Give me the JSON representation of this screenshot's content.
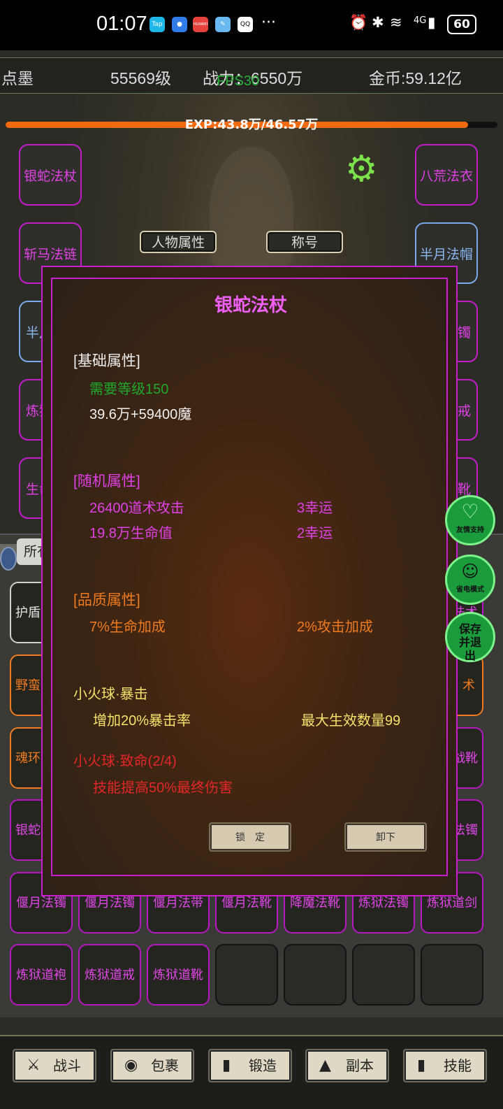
{
  "status_bar": {
    "time": "01:07",
    "apps": [
      "Tap",
      "●",
      "HUAWEI",
      "✎",
      "QQ"
    ],
    "more": "···",
    "network": "4G",
    "battery": "60"
  },
  "header": {
    "name": "点墨",
    "level": "55569级",
    "power": "战力：6550万",
    "gold": "金币:59.12亿",
    "fps": "FPS30"
  },
  "exp": {
    "text": "EXP:43.8万/46.57万",
    "fraction": 0.9405
  },
  "equip_left": [
    "银蛇法杖",
    "斩马法链",
    "半月",
    "炼狱",
    "生命"
  ],
  "equip_right": [
    "八荒法衣",
    "半月法帽",
    "法镯",
    "法戒",
    "法靴"
  ],
  "tabs": {
    "attributes": "人物属性",
    "title": "称号"
  },
  "filter_label": "所有",
  "grid_left": [
    "护盾",
    "野蛮",
    "魂环",
    "银蛇"
  ],
  "grid_right": [
    "法术",
    "战靴",
    "法镯"
  ],
  "grid_row1": [
    "偃月法镯",
    "偃月法镯",
    "偃月法带",
    "偃月法靴",
    "降魔法靴",
    "炼狱法镯",
    "炼狱道剑"
  ],
  "grid_row2": [
    "炼狱道袍",
    "炼狱道戒",
    "炼狱道靴"
  ],
  "modal": {
    "title": "银蛇法杖",
    "base_header": "[基础属性]",
    "req_level": "需要等级150",
    "base_value": "39.6万+59400魔",
    "random_header": "[随机属性]",
    "random": [
      [
        "26400道术攻击",
        "3幸运"
      ],
      [
        "19.8万生命值",
        "2幸运"
      ]
    ],
    "quality_header": "[品质属性]",
    "quality": [
      "7%生命加成",
      "2%攻击加成"
    ],
    "skill1": {
      "name": "小火球·暴击",
      "effect": "增加20%暴击率",
      "limit": "最大生效数量99"
    },
    "skill2": {
      "name": "小火球·致命(2/4)",
      "effect": "技能提高50%最终伤害"
    },
    "lock_btn": "锁　定",
    "unequip_btn": "卸下"
  },
  "floating": {
    "support": "友情支持",
    "power_save": "省电模式",
    "save_exit": "保存并退出"
  },
  "bottom_nav": [
    {
      "label": "战斗",
      "icon": "crossed-swords-icon"
    },
    {
      "label": "包裹",
      "icon": "bag-icon"
    },
    {
      "label": "锻造",
      "icon": "book-icon"
    },
    {
      "label": "副本",
      "icon": "tower-icon"
    },
    {
      "label": "技能",
      "icon": "book-icon"
    }
  ],
  "colors": {
    "accent": "#c91ecb",
    "exp": "#f26a0f",
    "green": "#1a9c3d"
  }
}
